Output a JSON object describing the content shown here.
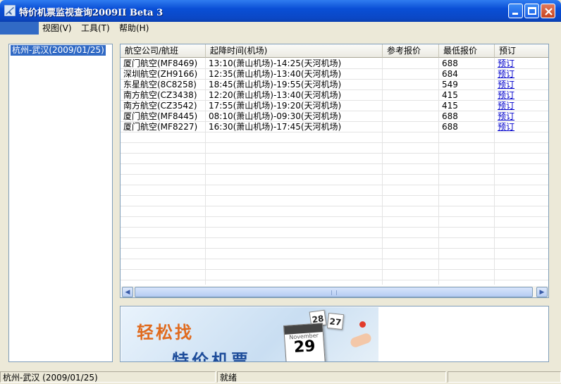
{
  "window": {
    "title": "特价机票监视查询2009II Beta 3"
  },
  "menu": [
    "视图(V)",
    "工具(T)",
    "帮助(H)"
  ],
  "tree": {
    "items": [
      "杭州-武汉(2009/01/25)"
    ]
  },
  "grid": {
    "columns": [
      "航空公司/航班",
      "起降时间(机场)",
      "参考报价",
      "最低报价",
      "预订"
    ],
    "rows": [
      {
        "airline": "厦门航空(MF8469)",
        "time": "13:10(萧山机场)-14:25(天河机场)",
        "ref_price": "",
        "lowest": "688",
        "book": "预订"
      },
      {
        "airline": "深圳航空(ZH9166)",
        "time": "12:35(萧山机场)-13:40(天河机场)",
        "ref_price": "",
        "lowest": "684",
        "book": "预订"
      },
      {
        "airline": "东星航空(8C8258)",
        "time": "18:45(萧山机场)-19:55(天河机场)",
        "ref_price": "",
        "lowest": "549",
        "book": "预订"
      },
      {
        "airline": "南方航空(CZ3438)",
        "time": "12:20(萧山机场)-13:40(天河机场)",
        "ref_price": "",
        "lowest": "415",
        "book": "预订"
      },
      {
        "airline": "南方航空(CZ3542)",
        "time": "17:55(萧山机场)-19:20(天河机场)",
        "ref_price": "",
        "lowest": "415",
        "book": "预订"
      },
      {
        "airline": "厦门航空(MF8445)",
        "time": "08:10(萧山机场)-09:30(天河机场)",
        "ref_price": "",
        "lowest": "688",
        "book": "预订"
      },
      {
        "airline": "厦门航空(MF8227)",
        "time": "16:30(萧山机场)-17:45(天河机场)",
        "ref_price": "",
        "lowest": "688",
        "book": "预订"
      }
    ]
  },
  "ad": {
    "slogan_line1": "轻松找",
    "slogan_line2": "特价机票",
    "calendar_month": "November",
    "calendar_day_large": "29",
    "calendar_days_small": [
      "28",
      "27"
    ]
  },
  "status": {
    "route": "杭州-武汉 (2009/01/25)",
    "state": "就绪",
    "extra": ""
  },
  "colors": {
    "titlebar": "#0a4fd6",
    "selection": "#316ac5",
    "link": "#0000cc",
    "ad_orange": "#e06b1f",
    "ad_blue": "#1d4c9a"
  }
}
